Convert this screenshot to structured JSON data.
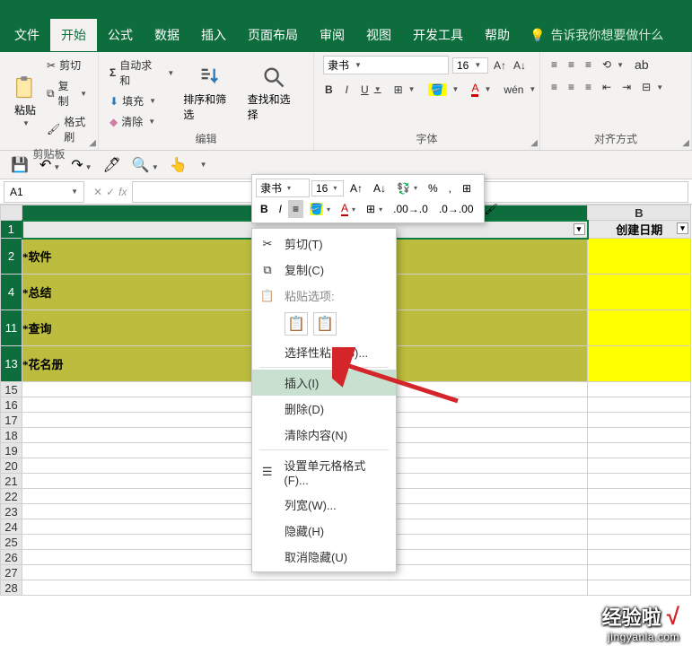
{
  "menubar": {
    "tabs": [
      "文件",
      "开始",
      "公式",
      "数据",
      "插入",
      "页面布局",
      "审阅",
      "视图",
      "开发工具",
      "帮助"
    ],
    "active_index": 1,
    "tell_me": "告诉我你想要做什么"
  },
  "ribbon": {
    "clipboard": {
      "paste": "粘贴",
      "cut": "剪切",
      "copy": "复制",
      "format_painter": "格式刷",
      "label": "剪贴板"
    },
    "editing": {
      "autosum": "自动求和",
      "fill": "填充",
      "clear": "清除",
      "sort": "排序和筛选",
      "find": "查找和选择",
      "label": "编辑"
    },
    "font": {
      "name": "隶书",
      "size": "16",
      "label": "字体"
    },
    "align": {
      "label": "对齐方式"
    }
  },
  "qat": {
    "items": [
      "save",
      "undo",
      "redo",
      "brush",
      "find",
      "touch"
    ]
  },
  "namebox": "A1",
  "columns": [
    "A",
    "B"
  ],
  "header_row": {
    "b": "创建日期"
  },
  "rows": [
    {
      "num": "1",
      "sel": true,
      "h": "hdr"
    },
    {
      "num": "2",
      "sel": true,
      "a": "*软件",
      "style": "olive bold tall"
    },
    {
      "num": "4",
      "sel": true,
      "a": "*总结",
      "style": "olive bold tall"
    },
    {
      "num": "11",
      "sel": true,
      "a": "*查询",
      "style": "olive bold tall"
    },
    {
      "num": "13",
      "sel": true,
      "a": "*花名册",
      "style": "olive bold tall"
    },
    {
      "num": "15"
    },
    {
      "num": "16"
    },
    {
      "num": "17"
    },
    {
      "num": "18"
    },
    {
      "num": "19"
    },
    {
      "num": "20"
    },
    {
      "num": "21"
    },
    {
      "num": "22"
    },
    {
      "num": "23"
    },
    {
      "num": "24"
    },
    {
      "num": "25"
    },
    {
      "num": "26"
    },
    {
      "num": "27"
    },
    {
      "num": "28"
    }
  ],
  "mini": {
    "font": "隶书",
    "size": "16"
  },
  "ctx": {
    "cut": "剪切(T)",
    "copy": "复制(C)",
    "paste_opts": "粘贴选项:",
    "paste_special": "选择性粘贴(S)...",
    "insert": "插入(I)",
    "delete": "删除(D)",
    "clear": "清除内容(N)",
    "format": "设置单元格格式(F)...",
    "colwidth": "列宽(W)...",
    "hide": "隐藏(H)",
    "unhide": "取消隐藏(U)"
  },
  "watermark": {
    "l1": "经验啦",
    "l2": "jingyanla.com"
  }
}
